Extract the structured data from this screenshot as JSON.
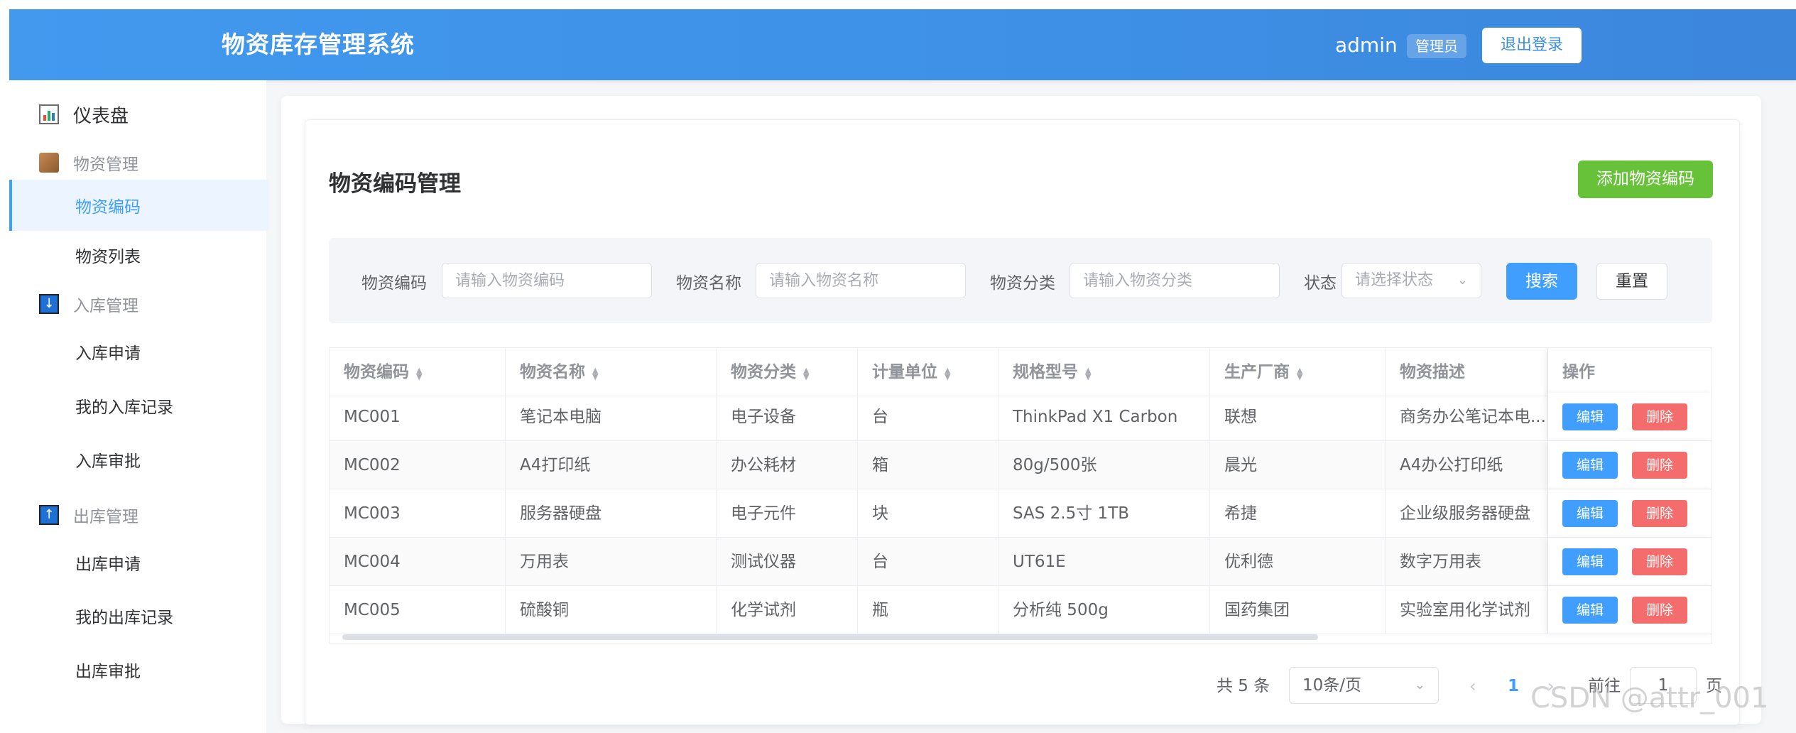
{
  "header": {
    "title": "物资库存管理系统",
    "username": "admin",
    "role_badge": "管理员",
    "logout_label": "退出登录"
  },
  "sidebar": {
    "dashboard": "仪表盘",
    "groups": [
      {
        "label": "物资管理",
        "items": [
          "物资编码",
          "物资列表"
        ]
      },
      {
        "label": "入库管理",
        "items": [
          "入库申请",
          "我的入库记录",
          "入库审批"
        ]
      },
      {
        "label": "出库管理",
        "items": [
          "出库申请",
          "我的出库记录",
          "出库审批"
        ]
      }
    ],
    "active": "物资编码"
  },
  "main": {
    "title": "物资编码管理",
    "add_button": "添加物资编码"
  },
  "search": {
    "code_label": "物资编码",
    "code_placeholder": "请输入物资编码",
    "name_label": "物资名称",
    "name_placeholder": "请输入物资名称",
    "category_label": "物资分类",
    "category_placeholder": "请输入物资分类",
    "status_label": "状态",
    "status_placeholder": "请选择状态",
    "search_button": "搜索",
    "reset_button": "重置"
  },
  "table": {
    "columns": [
      "物资编码",
      "物资名称",
      "物资分类",
      "计量单位",
      "规格型号",
      "生产厂商",
      "物资描述",
      "操作"
    ],
    "rows": [
      [
        "MC001",
        "笔记本电脑",
        "电子设备",
        "台",
        "ThinkPad X1 Carbon",
        "联想",
        "商务办公笔记本电..."
      ],
      [
        "MC002",
        "A4打印纸",
        "办公耗材",
        "箱",
        "80g/500张",
        "晨光",
        "A4办公打印纸"
      ],
      [
        "MC003",
        "服务器硬盘",
        "电子元件",
        "块",
        "SAS 2.5寸 1TB",
        "希捷",
        "企业级服务器硬盘"
      ],
      [
        "MC004",
        "万用表",
        "测试仪器",
        "台",
        "UT61E",
        "优利德",
        "数字万用表"
      ],
      [
        "MC005",
        "硫酸铜",
        "化学试剂",
        "瓶",
        "分析纯 500g",
        "国药集团",
        "实验室用化学试剂"
      ]
    ],
    "edit_label": "编辑",
    "delete_label": "删除"
  },
  "pagination": {
    "total": "共 5 条",
    "page_size": "10条/页",
    "prev": "‹",
    "next": "›",
    "current_page": "1",
    "goto_label": "前往",
    "goto_value": "1",
    "page_suffix": "页"
  },
  "watermark": "CSDN @attr_001",
  "colors": {
    "primary": "#409eff",
    "success": "#67c23a",
    "danger": "#f56c6c",
    "header_start": "#4299ee",
    "header_end": "#3c86dc"
  },
  "icons": {
    "dashboard": "bar-chart-icon",
    "materials": "package-icon",
    "inbound": "arrow-down-icon",
    "outbound": "arrow-up-icon"
  }
}
